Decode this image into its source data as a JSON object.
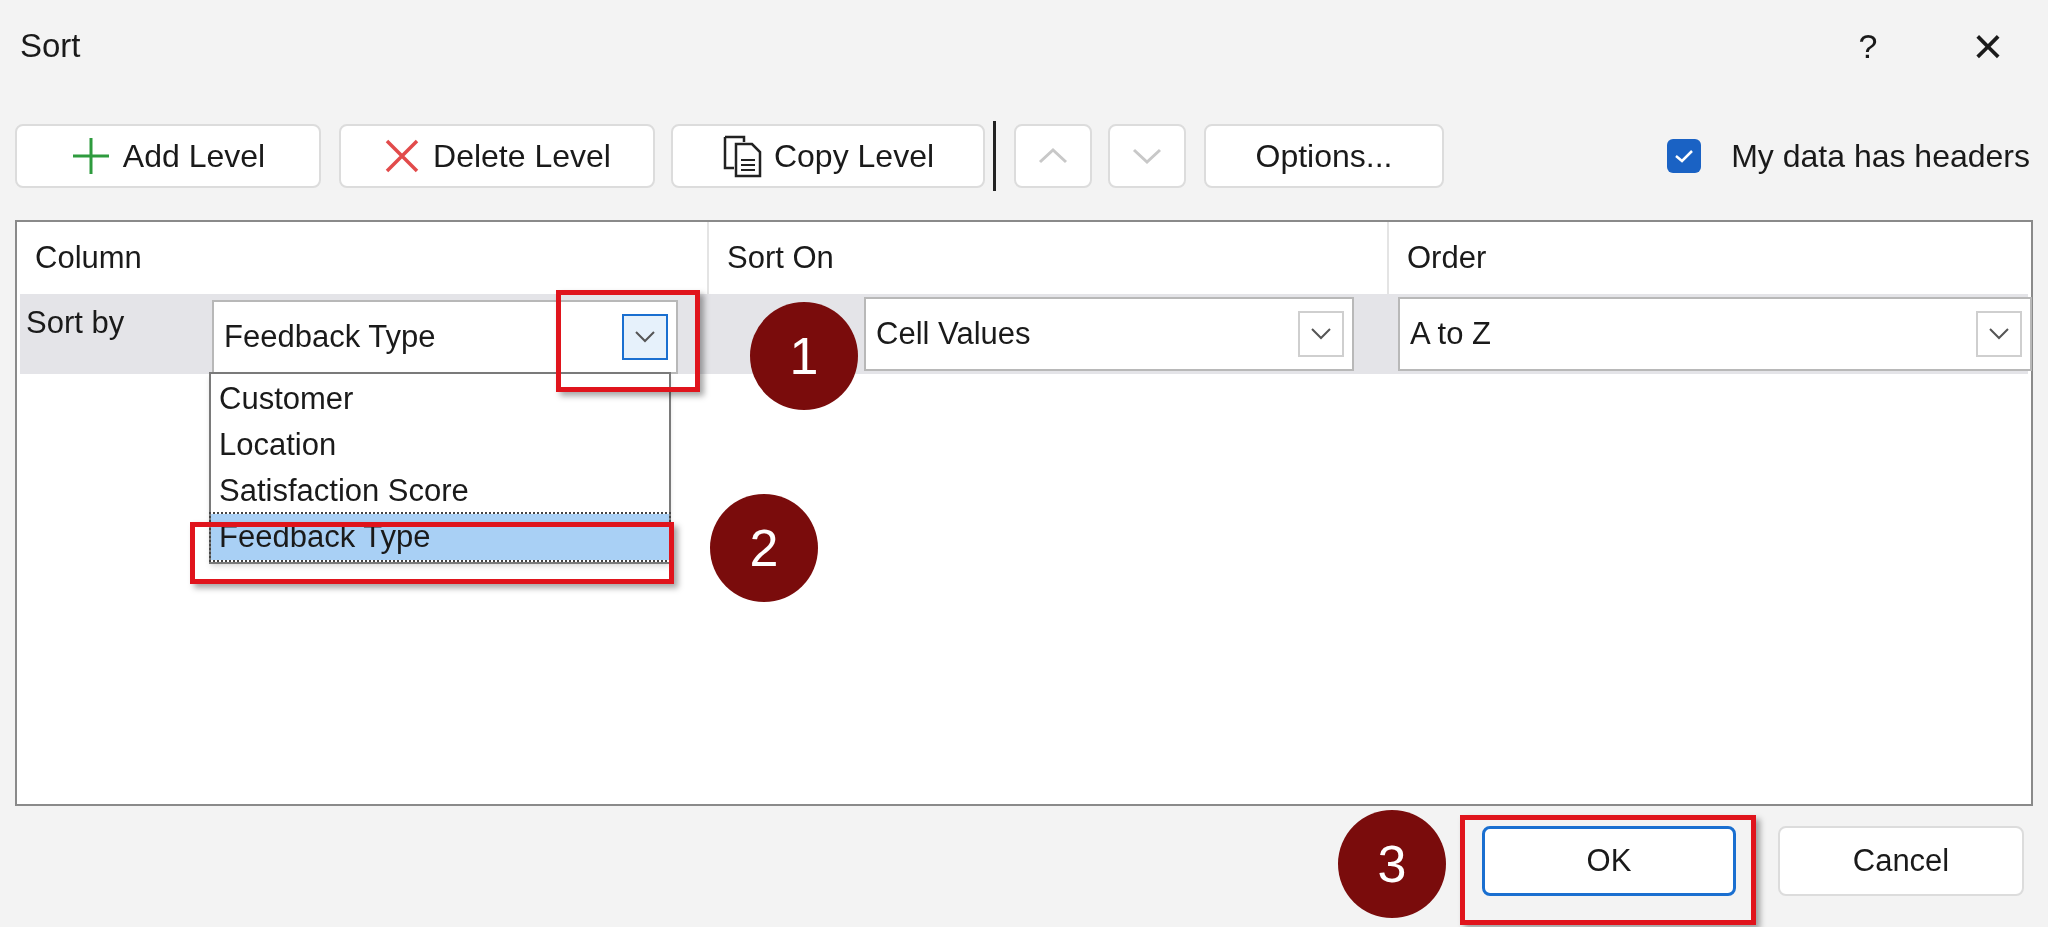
{
  "window": {
    "title": "Sort",
    "help": "?",
    "close": "×"
  },
  "toolbar": {
    "buttons": [
      {
        "kind": "add",
        "label": "Add Level",
        "disabled": false
      },
      {
        "kind": "delete",
        "label": "Delete Level",
        "disabled": false
      },
      {
        "kind": "copy",
        "label": "Copy Level",
        "disabled": false
      },
      {
        "kind": "up",
        "disabled": true
      },
      {
        "kind": "down",
        "disabled": true
      },
      {
        "kind": "plain",
        "label": "Options...",
        "disabled": false
      }
    ],
    "headers_checkbox": {
      "label": "My data has headers",
      "checked": true
    }
  },
  "table": {
    "columns": [
      "Column",
      "Sort On",
      "Order"
    ],
    "rows": [
      {
        "label": "Sort by",
        "column": "Feedback Type",
        "sort_on": "Cell Values",
        "order": "A to Z",
        "expanded": true
      }
    ]
  },
  "dropdown": {
    "items": [
      {
        "label": "Customer",
        "selected": false
      },
      {
        "label": "Location",
        "selected": false
      },
      {
        "label": "Satisfaction Score",
        "selected": false
      },
      {
        "label": "Feedback Type",
        "selected": true
      }
    ]
  },
  "annotations": [
    {
      "number": "1"
    },
    {
      "number": "2"
    },
    {
      "number": "3"
    }
  ],
  "footer": {
    "buttons": [
      {
        "label": "OK",
        "default": true
      },
      {
        "label": "Cancel",
        "default": false
      }
    ]
  }
}
